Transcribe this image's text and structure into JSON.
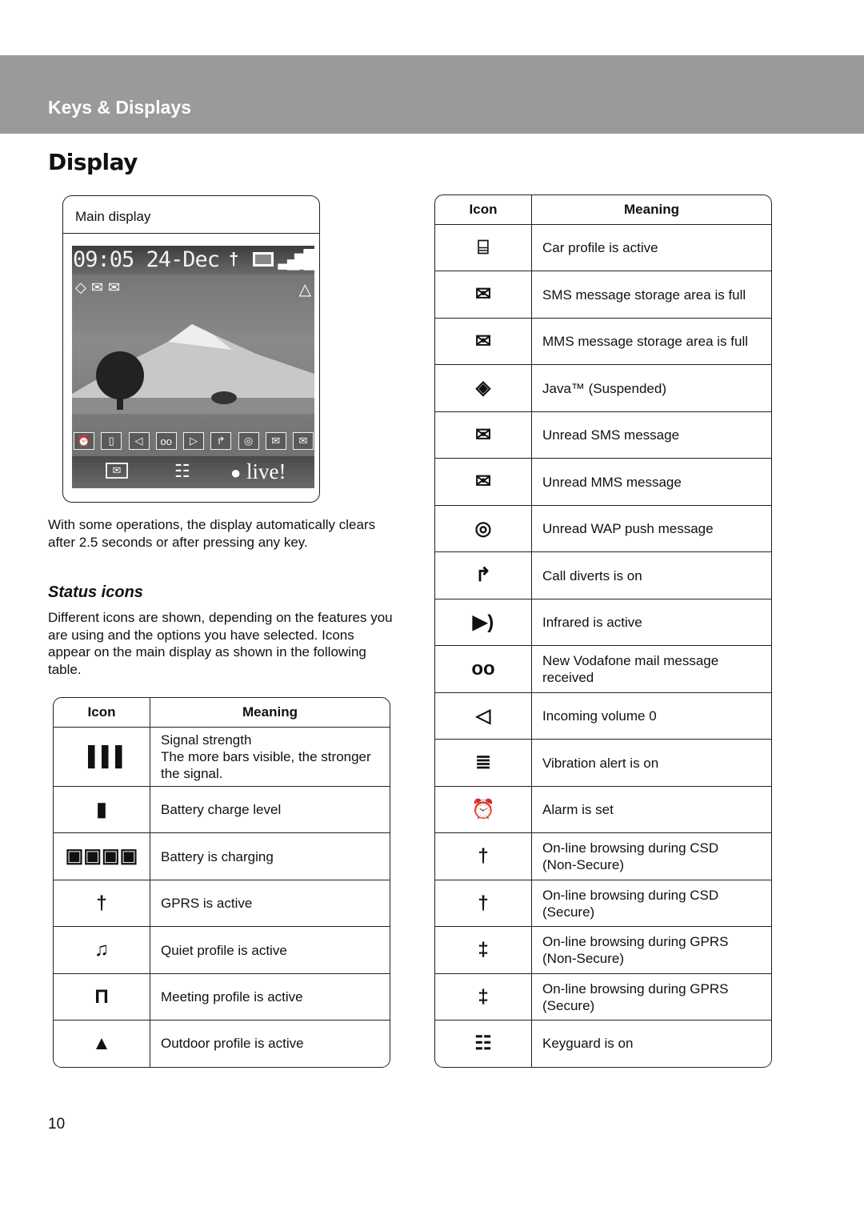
{
  "header": {
    "section_title": "Keys & Displays"
  },
  "page_title": "Display",
  "main_display": {
    "caption": "Main display",
    "clock_text": "09:05 24-Dec",
    "top_status_icons": [
      "gprs-icon",
      "battery-icon",
      "signal-icon"
    ],
    "second_row_icons": [
      "java-icon",
      "mms-full-icon",
      "sms-full-icon",
      "outdoor-profile-icon"
    ],
    "bottom_row_icons": [
      "alarm-icon",
      "vibration-icon",
      "volume-off-icon",
      "voicemail-icon",
      "infrared-icon",
      "divert-icon",
      "wap-push-icon",
      "mms-icon",
      "sms-icon"
    ],
    "softkeys": {
      "left": "envelope-icon",
      "center": "keyguard-icon",
      "right_text": "live!"
    },
    "glyphs": {
      "gprs": "†",
      "battery": "▭",
      "signal": "▐",
      "java": "◇",
      "mms_full": "✉",
      "sms_full": "✉",
      "outdoor": "△",
      "alarm": "⏰",
      "vibration": "▯",
      "vol": "◁",
      "vm": "oo",
      "ir": "▷",
      "divert": "↱",
      "wap": "◎",
      "mms": "✉",
      "sms": "✉",
      "env": "✉",
      "key": "☷",
      "live_dot": "●"
    }
  },
  "intro_paragraph": "With some operations, the display automatically clears after 2.5 seconds or after pressing any key.",
  "status_icons": {
    "heading": "Status icons",
    "paragraph": "Different icons are shown, depending on the features you are using and the options you have selected. Icons appear on the main display as shown in the following table."
  },
  "table_headers": {
    "icon": "Icon",
    "meaning": "Meaning"
  },
  "left_table": [
    {
      "icon": "signal-strength-icon",
      "glyph": "▐▐▐",
      "meaning_lines": [
        "Signal strength",
        "The more bars visible, the stronger the signal."
      ]
    },
    {
      "icon": "battery-charge-icon",
      "glyph": "▮",
      "meaning_lines": [
        "Battery charge level"
      ]
    },
    {
      "icon": "battery-charging-icon",
      "glyph": "▣▣▣▣",
      "meaning_lines": [
        "Battery is charging"
      ]
    },
    {
      "icon": "gprs-icon",
      "glyph": "†",
      "meaning_lines": [
        "GPRS is active"
      ]
    },
    {
      "icon": "quiet-profile-icon",
      "glyph": "♫",
      "meaning_lines": [
        "Quiet profile is active"
      ]
    },
    {
      "icon": "meeting-profile-icon",
      "glyph": "Π",
      "meaning_lines": [
        "Meeting profile is active"
      ]
    },
    {
      "icon": "outdoor-profile-icon",
      "glyph": "▲",
      "meaning_lines": [
        "Outdoor profile is active"
      ]
    }
  ],
  "right_table": [
    {
      "icon": "car-profile-icon",
      "glyph": "⌸",
      "meaning_lines": [
        "Car profile is active"
      ]
    },
    {
      "icon": "sms-full-icon",
      "glyph": "✉",
      "meaning_lines": [
        "SMS message storage area is full"
      ]
    },
    {
      "icon": "mms-full-icon",
      "glyph": "✉",
      "meaning_lines": [
        "MMS message storage area is full"
      ]
    },
    {
      "icon": "java-suspended-icon",
      "glyph": "◈",
      "meaning_lines": [
        "Java™ (Suspended)"
      ]
    },
    {
      "icon": "unread-sms-icon",
      "glyph": "✉",
      "meaning_lines": [
        "Unread SMS message"
      ]
    },
    {
      "icon": "unread-mms-icon",
      "glyph": "✉",
      "meaning_lines": [
        "Unread MMS message"
      ]
    },
    {
      "icon": "unread-wap-push-icon",
      "glyph": "◎",
      "meaning_lines": [
        "Unread WAP push message"
      ]
    },
    {
      "icon": "call-divert-icon",
      "glyph": "↱",
      "meaning_lines": [
        "Call diverts is on"
      ]
    },
    {
      "icon": "infrared-icon",
      "glyph": "▶)",
      "meaning_lines": [
        "Infrared is active"
      ]
    },
    {
      "icon": "voicemail-icon",
      "glyph": "oo",
      "meaning_lines": [
        "New Vodafone mail message",
        "received"
      ]
    },
    {
      "icon": "volume-zero-icon",
      "glyph": "◁",
      "meaning_lines": [
        "Incoming volume 0"
      ]
    },
    {
      "icon": "vibration-icon",
      "glyph": "≣",
      "meaning_lines": [
        "Vibration alert is on"
      ]
    },
    {
      "icon": "alarm-icon",
      "glyph": "⏰",
      "meaning_lines": [
        "Alarm is set"
      ]
    },
    {
      "icon": "csd-nonsecure-icon",
      "glyph": "†",
      "meaning_lines": [
        "On-line browsing during CSD",
        "(Non-Secure)"
      ]
    },
    {
      "icon": "csd-secure-icon",
      "glyph": "†",
      "meaning_lines": [
        "On-line browsing during CSD",
        "(Secure)"
      ]
    },
    {
      "icon": "gprs-nonsecure-icon",
      "glyph": "‡",
      "meaning_lines": [
        "On-line browsing during GPRS",
        "(Non-Secure)"
      ]
    },
    {
      "icon": "gprs-secure-icon",
      "glyph": "‡",
      "meaning_lines": [
        "On-line browsing during GPRS",
        "(Secure)"
      ]
    },
    {
      "icon": "keyguard-icon",
      "glyph": "☷",
      "meaning_lines": [
        "Keyguard is on"
      ]
    }
  ],
  "page_number": "10"
}
